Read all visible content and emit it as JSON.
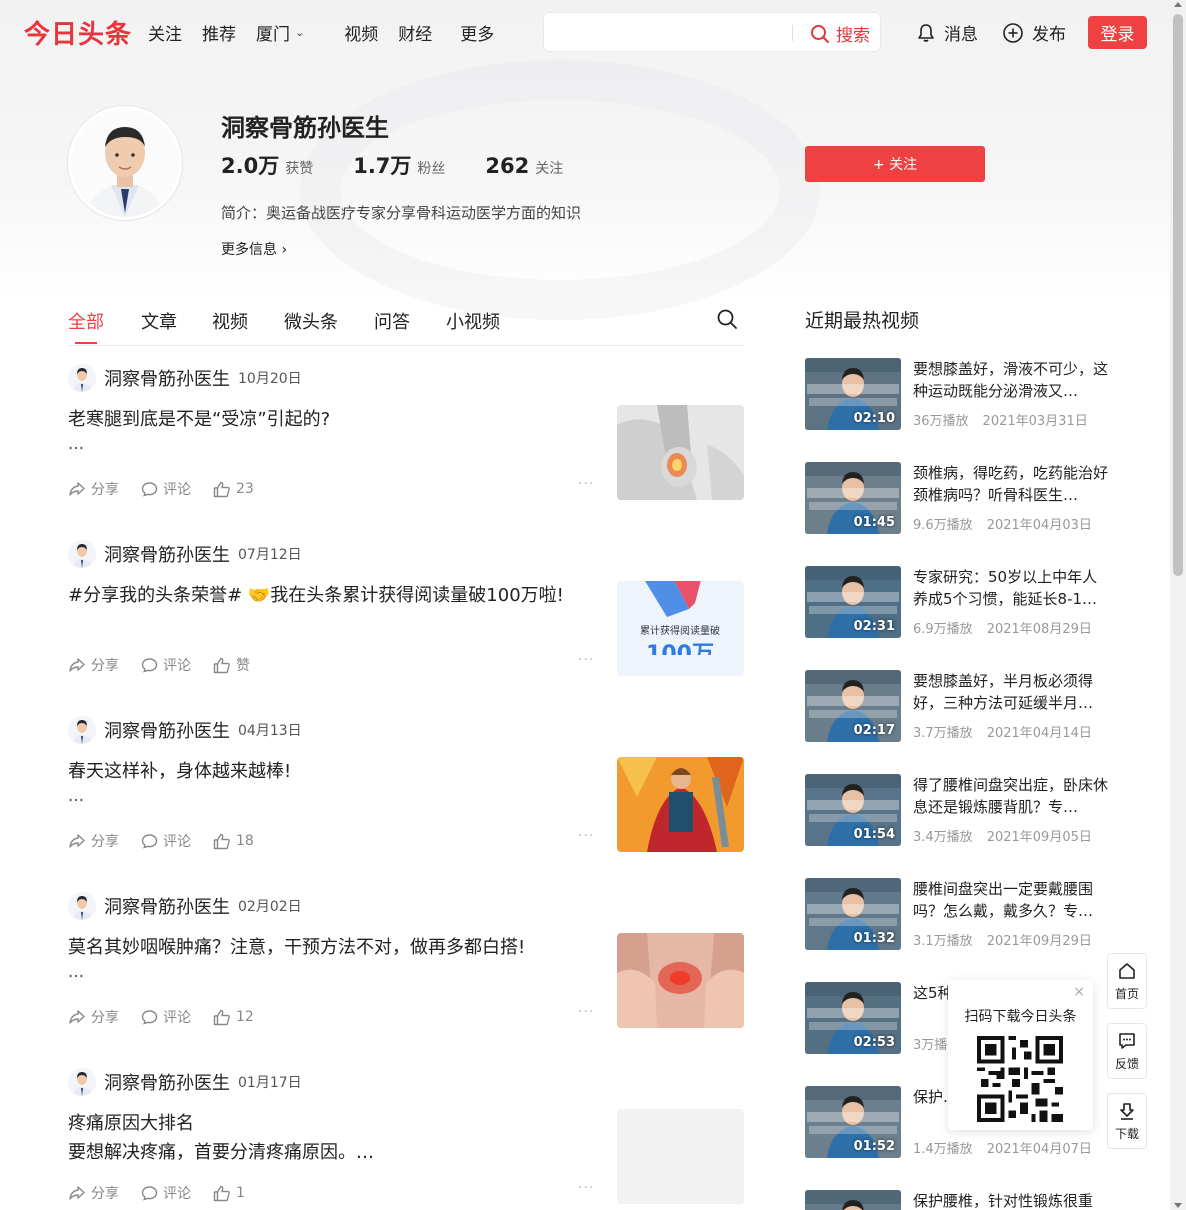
{
  "header": {
    "logo": "今日头条",
    "nav": [
      "关注",
      "推荐",
      "厦门",
      "视频",
      "财经",
      "更多"
    ],
    "search_button": "搜索",
    "search_placeholder": "",
    "messages": "消息",
    "publish": "发布",
    "login": "登录"
  },
  "profile": {
    "name": "洞察骨筋孙医生",
    "likes_num": "2.0万",
    "likes_label": "获赞",
    "fans_num": "1.7万",
    "fans_label": "粉丝",
    "following_num": "262",
    "following_label": "关注",
    "bio": "简介：奥运备战医疗专家分享骨科运动医学方面的知识",
    "more_info": "更多信息",
    "follow_button": "+ 关注"
  },
  "tabs": [
    "全部",
    "文章",
    "视频",
    "微头条",
    "问答",
    "小视频"
  ],
  "actions": {
    "share": "分享",
    "comment": "评论"
  },
  "posts": [
    {
      "author": "洞察骨筋孙医生",
      "date": "10月20日",
      "title": "老寒腿到底是不是“受凉”引起的?",
      "sub": "…",
      "likes": "23"
    },
    {
      "author": "洞察骨筋孙医生",
      "date": "07月12日",
      "title": "#分享我的头条荣誉# 🤝我在头条累计获得阅读量破100万啦!",
      "sub": "",
      "likes": "赞",
      "thumb_text": "累计获得阅读量破",
      "thumb_big": "100万"
    },
    {
      "author": "洞察骨筋孙医生",
      "date": "04月13日",
      "title": "春天这样补，身体越来越棒!",
      "sub": "…",
      "likes": "18"
    },
    {
      "author": "洞察骨筋孙医生",
      "date": "02月02日",
      "title": "莫名其妙咽喉肿痛？注意，干预方法不对，做再多都白搭!",
      "sub": "…",
      "likes": "12"
    },
    {
      "author": "洞察骨筋孙医生",
      "date": "01月17日",
      "title": "疼痛原因大排名",
      "sub": "要想解决疼痛，首要分清疼痛原因。…",
      "likes": "1"
    }
  ],
  "hot": {
    "title": "近期最热视频",
    "videos": [
      {
        "title": "要想膝盖好，滑液不可少，这种运动既能分泌滑液又…",
        "duration": "02:10",
        "plays": "36万播放",
        "date": "2021年03月31日"
      },
      {
        "title": "颈椎病，得吃药，吃药能治好颈椎病吗？听骨科医生…",
        "duration": "01:45",
        "plays": "9.6万播放",
        "date": "2021年04月03日"
      },
      {
        "title": "专家研究：50岁以上中年人养成5个习惯，能延长8-1…",
        "duration": "02:31",
        "plays": "6.9万播放",
        "date": "2021年08月29日"
      },
      {
        "title": "要想膝盖好，半月板必须得好，三种方法可延缓半月…",
        "duration": "02:17",
        "plays": "3.7万播放",
        "date": "2021年04月14日"
      },
      {
        "title": "得了腰椎间盘突出症，卧床休息还是锻炼腰背肌？专…",
        "duration": "01:54",
        "plays": "3.4万播放",
        "date": "2021年09月05日"
      },
      {
        "title": "腰椎间盘突出一定要戴腰围吗？怎么戴，戴多久？专…",
        "duration": "01:32",
        "plays": "3.1万播放",
        "date": "2021年09月29日"
      },
      {
        "title": "这5种… 实不…",
        "duration": "02:53",
        "plays": "3万播",
        "date": ""
      },
      {
        "title": "保护… 福，…",
        "duration": "01:52",
        "plays": "1.4万播放",
        "date": "2021年04月07日"
      },
      {
        "title": "保护腰椎，针对性锻炼很重",
        "duration": "",
        "plays": "",
        "date": ""
      }
    ]
  },
  "float": {
    "qr_text": "扫码下载今日头条",
    "close": "×",
    "home": "首页",
    "feedback": "反馈",
    "download": "下载"
  },
  "colors": {
    "accent": "#f04142",
    "logo": "#e8343a"
  }
}
